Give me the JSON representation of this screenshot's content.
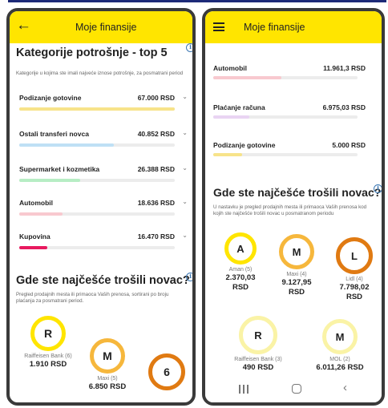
{
  "left": {
    "appbar_title": "Moje finansije",
    "categories": {
      "title": "Kategorije potrošnje - top 5",
      "description": "Kategorije u kojima ste imali najveće iznose potrošnje, za posmatrani period",
      "items": [
        {
          "name": "Podizanje gotovine",
          "amount": "67.000 RSD",
          "share": 1.0,
          "color": "#f7e38a"
        },
        {
          "name": "Ostali transferi novca",
          "amount": "40.852 RSD",
          "share": 0.61,
          "color": "#bfe0f5"
        },
        {
          "name": "Supermarket i kozmetika",
          "amount": "26.388 RSD",
          "share": 0.39,
          "color": "#b7edc4"
        },
        {
          "name": "Automobil",
          "amount": "18.636 RSD",
          "share": 0.28,
          "color": "#f8c9cf"
        },
        {
          "name": "Kupovina",
          "amount": "16.470 RSD",
          "share": 0.18,
          "color": "#e8195f"
        }
      ]
    },
    "merchants": {
      "title": "Gde ste najčešće trošili novac?",
      "description": "Pregled prodajnih mesta ili primaoca Vaših prenosa, sortirani po broju plaćanja za posmatrani period.",
      "items": [
        {
          "letter": "R",
          "name": "Raiffeisen Bank (6)",
          "amount": "1.910 RSD",
          "ring": "#ffe500"
        },
        {
          "letter": "M",
          "name": "Maxi (5)",
          "amount": "6.850 RSD",
          "ring": "#f6b73c"
        },
        {
          "letter": "6",
          "name": "",
          "amount": "",
          "ring": "#e07a12"
        }
      ]
    }
  },
  "right": {
    "appbar_title": "Moje finansije",
    "categories": [
      {
        "name": "Automobil",
        "amount": "11.961,3 RSD",
        "share": 0.47,
        "color": "#f8c9cf"
      },
      {
        "name": "Plaćanje računa",
        "amount": "6.975,03 RSD",
        "share": 0.25,
        "color": "#e9d4f3"
      },
      {
        "name": "Podizanje gotovine",
        "amount": "5.000 RSD",
        "share": 0.2,
        "color": "#f7e38a"
      }
    ],
    "merchants": {
      "title": "Gde ste najčešće trošili novac?",
      "description": "U nastavku je pregled prodajnih mesta ili primaoca Vaših prenosa kod kojih ste najčešće trošili novac u posmatranom periodu",
      "items": [
        {
          "letter": "A",
          "name": "Aman (5)",
          "amount": "2.370,03 RSD",
          "ring": "#ffe500"
        },
        {
          "letter": "M",
          "name": "Maxi (4)",
          "amount": "9.127,95 RSD",
          "ring": "#f6b73c"
        },
        {
          "letter": "L",
          "name": "Lidl (4)",
          "amount": "7.798,02 RSD",
          "ring": "#e07a12"
        },
        {
          "letter": "R",
          "name": "Raiffeisen Bank (3)",
          "amount": "490 RSD",
          "ring": "#faf3a6"
        },
        {
          "letter": "M",
          "name": "MOL (2)",
          "amount": "6.011,26 RSD",
          "ring": "#faf3a6"
        }
      ]
    }
  },
  "icons": {
    "back": "arrow-left-icon",
    "menu": "hamburger-menu-icon",
    "info": "info-icon",
    "chevron": "chevron-down-icon",
    "nav_recents": "recents-icon",
    "nav_home": "home-icon",
    "nav_back": "back-icon"
  }
}
